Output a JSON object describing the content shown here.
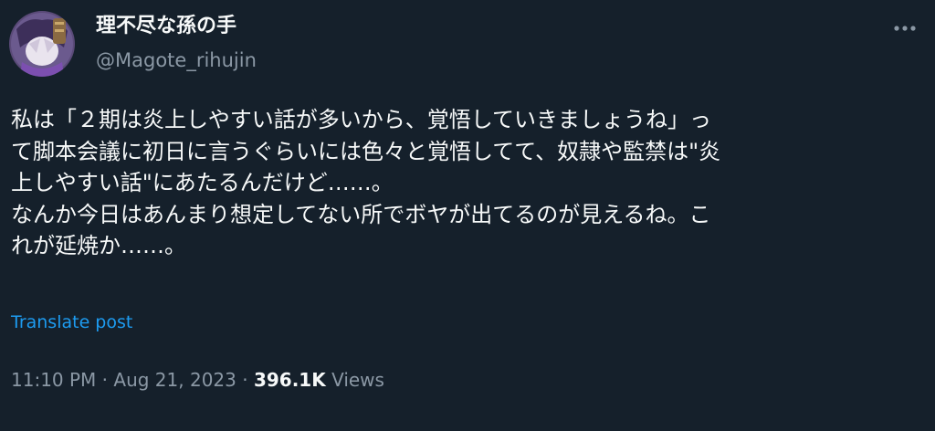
{
  "author": {
    "display_name": "理不尽な孫の手",
    "handle": "@Magote_rihujin"
  },
  "post": {
    "text_lines": [
      "私は「２期は炎上しやすい話が多いから、覚悟していきましょうね」っ",
      "て脚本会議に初日に言うぐらいには色々と覚悟してて、奴隷や監禁は\"炎",
      "上しやすい話\"にあたるんだけど……。",
      "なんか今日はあんまり想定してない所でボヤが出てるのが見えるね。こ",
      "れが延焼か……。"
    ],
    "translate_label": "Translate post"
  },
  "meta": {
    "time": "11:10 PM",
    "separator": " · ",
    "date": "Aug 21, 2023",
    "views_count": "396.1K",
    "views_label": " Views"
  },
  "icons": {
    "more": "more-horizontal-icon"
  },
  "colors": {
    "background": "#15202b",
    "primary_text": "#f7f9f9",
    "secondary_text": "#8b98a5",
    "link": "#1d9bf0"
  }
}
